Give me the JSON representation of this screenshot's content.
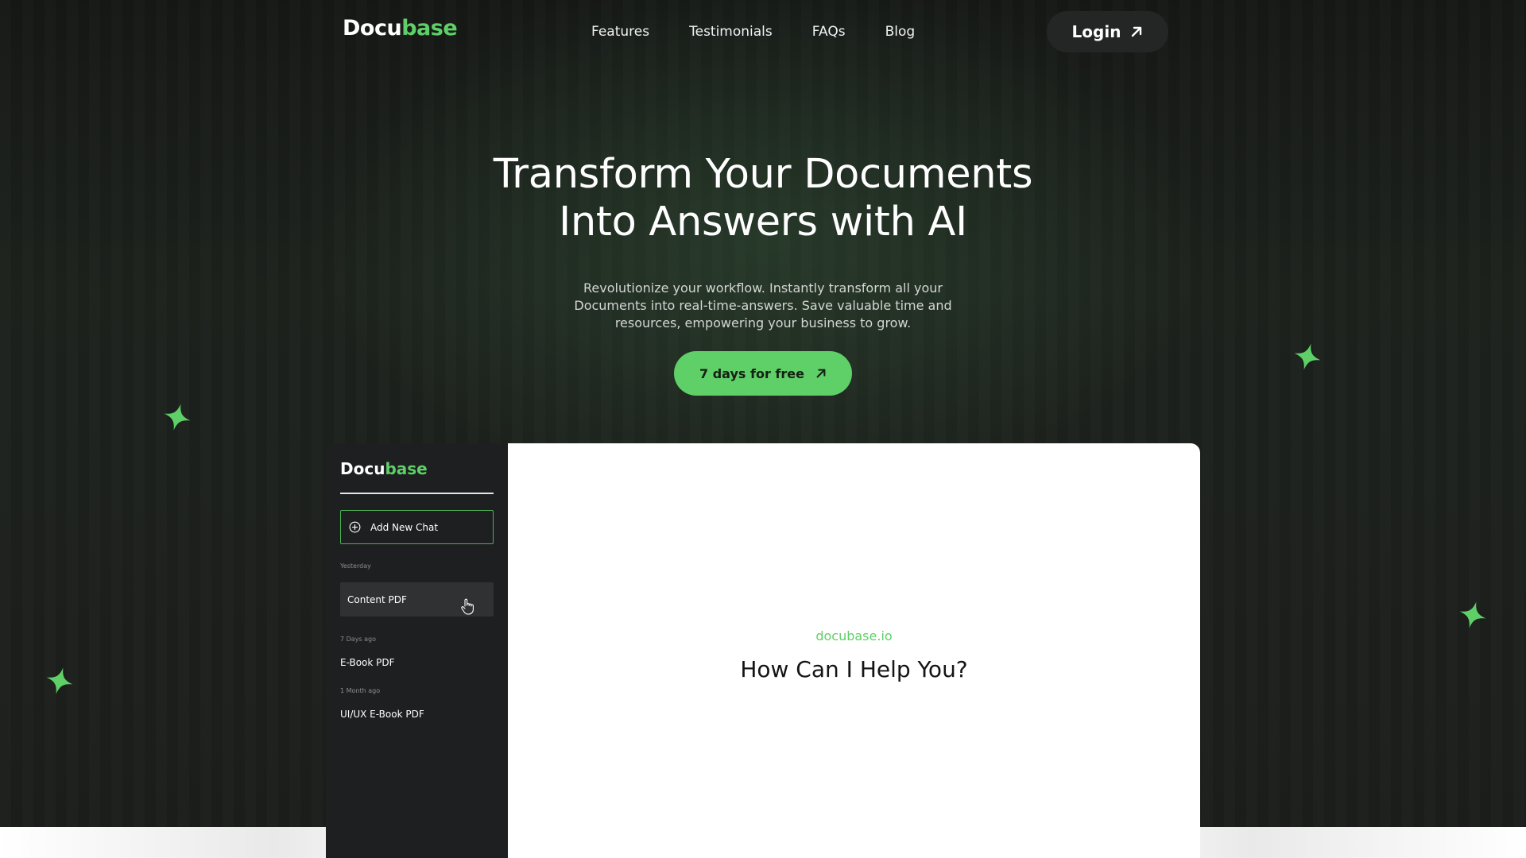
{
  "header": {
    "logo_part1": "Docu",
    "logo_part2": "base",
    "nav": [
      "Features",
      "Testimonials",
      "FAQs",
      "Blog"
    ],
    "login_label": "Login"
  },
  "hero": {
    "title_line1": "Transform Your Documents",
    "title_line2": "Into Answers with AI",
    "subtitle_line1": "Revolutionize your workflow. Instantly transform all your",
    "subtitle_line2": "Documents into real-time-answers. Save valuable time and",
    "subtitle_line3": "resources, empowering your business to grow.",
    "cta_label": "7 days for free"
  },
  "preview": {
    "sidebar": {
      "logo_part1": "Docu",
      "logo_part2": "base",
      "add_chat_label": "Add New Chat",
      "groups": [
        {
          "label": "Yesterday",
          "items": [
            "Content PDF"
          ]
        },
        {
          "label": "7 Days ago",
          "items": [
            "E-Book PDF"
          ]
        },
        {
          "label": "1 Month ago",
          "items": [
            "UI/UX E-Book PDF"
          ]
        }
      ]
    },
    "main": {
      "domain": "docubase.io",
      "question": "How Can I Help You?"
    }
  },
  "colors": {
    "accent": "#5fcf68",
    "background": "#1a1c1a",
    "sidebar": "#1e1f21",
    "main_panel": "#ffffff"
  },
  "icons": [
    "arrow-up-right-icon",
    "plus-circle-icon",
    "hand-cursor-icon",
    "sparkle-icon"
  ]
}
